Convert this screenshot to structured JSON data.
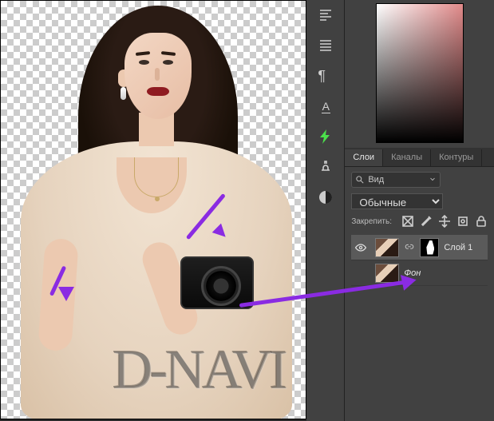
{
  "watermark": "D-NAVI",
  "side_tools": [
    {
      "name": "align-icon"
    },
    {
      "name": "justify-icon"
    },
    {
      "name": "paragraph-icon"
    },
    {
      "name": "character-icon"
    },
    {
      "name": "flash-icon"
    },
    {
      "name": "clone-stamp-icon"
    },
    {
      "name": "swatches-icon"
    }
  ],
  "tabs": {
    "layers": "Слои",
    "channels": "Каналы",
    "paths": "Контуры"
  },
  "search": {
    "label": "Вид",
    "icon": "search"
  },
  "blend_mode": "Обычные",
  "lock_label": "Закрепить:",
  "layers_list": [
    {
      "name": "Слой 1",
      "has_mask": true,
      "visible": true,
      "selected": true
    },
    {
      "name": "Фон",
      "has_mask": false,
      "visible": true,
      "selected": false,
      "bg": true
    }
  ]
}
